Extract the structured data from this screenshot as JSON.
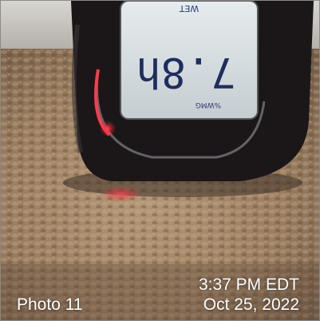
{
  "photo": {
    "label": "Photo 11",
    "time": "3:37 PM EDT",
    "date": "Oct 25, 2022"
  },
  "meter_display": {
    "top_text": "WET",
    "reading": "7.8h",
    "mode_text": "%WMG"
  },
  "colors": {
    "carpet": "#9c8062",
    "meter_body": "#1b1718",
    "lcd": "#cfd7da",
    "led_red": "#ff3b4c",
    "caption_text": "#ffffff"
  }
}
